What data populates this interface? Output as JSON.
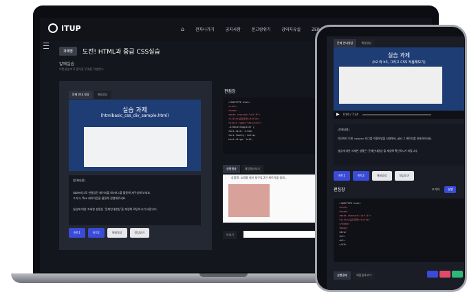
{
  "laptop": {
    "logo": "ITUP",
    "nav": [
      "전자나가기",
      "공지사항",
      "문고랑쉬기",
      "강의자유실",
      "ZEP 무"
    ],
    "badge": "과제명",
    "title": "도전! HTML과 중급 CSS실습",
    "subtitle": "앞에실습",
    "subsubtitle": "이번실습에 꼭 들어갈 무엇을 작성한다.",
    "tabs": [
      "문제 안내 영상",
      "해설영상"
    ],
    "slide_title": "실습 과제",
    "slide_subtitle": "(htmlbasic_css_div_sample.html)",
    "desc_title": "[문제내용]",
    "desc_lines": [
      "table태그로 만들었던 페이지를 div태그를 활용해 재구성해 보세요.",
      "그리고, flex 레이아웃을 활용해 정렬해주세요.",
      "",
      "실습에 대한 자세한 설명은 ‘문제안내영상’을 재생해 확인하시기 바랍니다."
    ],
    "buttons": [
      "힌트1",
      "힌트2",
      "해설영상",
      "정답보기"
    ],
    "editor_label": "편집창",
    "code_lines": [
      "<!DOCTYPE html>",
      "<html>",
      "",
      "<head>",
      "  <meta charset=\"utf-8\">",
      "  <title>실습과제</title>",
      "  <style type=\"text/css\">",
      "    .productsupplier {",
      "      font-size: 1.5em;",
      "      font-family: Gulim;",
      "      text-align: left;"
    ],
    "result_tabs": [
      "실행결과",
      "채점결과보기"
    ],
    "result_text": "상품명: 쇼핑몰 최신 침구류 2인 세트이불 침대...",
    "search_label": "보내기"
  },
  "phone": {
    "tabs": [
      "문제 안내영상",
      "해설영상"
    ],
    "slide_title": "실습 과제",
    "slide_subtitle": "(h2 와 h3, 그리고 CSS 적용해보기)",
    "time": "0:00 / 7:34",
    "desc_title": "[문제내용]",
    "desc_lines": [
      "이전까지 익힌 <style> 태그를 적용하였을 사용해서, 글씨 그 페이지를 만들어보세요.",
      "",
      "실습에 대한 자세한 설명은 ‘문제안내영상’을 재생해 확인하시기 바랍니다."
    ],
    "buttons": [
      "힌트1",
      "힌트2",
      "해설영상",
      "정답보기"
    ],
    "editor_label": "편집창",
    "editor_right": [
      "초기화",
      "실행"
    ],
    "code_lines": [
      "<!DOCTYPE html>",
      "<html>",
      "<head>",
      "  <meta charset=\"utf-8\">",
      "  <title>실습과제</title>",
      "</head>",
      "<body>",
      "  <div>",
      "    <h1>",
      "      <h2>",
      "      </h2>"
    ],
    "footer_tabs": [
      "실행결과",
      "채점결과보기"
    ],
    "footer_colors": [
      "#3a4bd8",
      "#e24a6a",
      "#2db87a"
    ]
  }
}
